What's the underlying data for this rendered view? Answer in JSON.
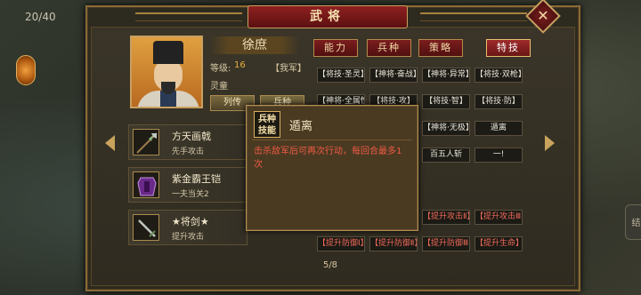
{
  "background": {
    "counter": "20/40",
    "side_button": "结"
  },
  "window": {
    "title": "武将",
    "close_icon": "close-icon"
  },
  "general": {
    "name": "徐庶",
    "level_label": "等级:",
    "level_value": "16",
    "faction": "【我军】",
    "attribute": "灵童",
    "bio_button": "列传",
    "troop_button": "兵种"
  },
  "tabs": [
    {
      "label": "能力",
      "active": false
    },
    {
      "label": "兵种",
      "active": false
    },
    {
      "label": "策略",
      "active": false
    },
    {
      "label": "特技",
      "active": true
    }
  ],
  "skills": {
    "row1": [
      "【将技·圣灵】",
      "【神将·奋战】",
      "【神将·异常】",
      "【将技·双枪】"
    ],
    "row2": [
      "【神将·全属性】",
      "【将技·攻】",
      "【将技·智】",
      "【将技·防】"
    ],
    "row3": [
      "【神将·无极】",
      "遁离"
    ],
    "row4": [
      "百五人斩",
      "一!"
    ],
    "row5": [
      "【提升攻击Ⅱ】",
      "【提升攻击Ⅲ】"
    ],
    "row6": [
      "【提升防御Ⅰ】",
      "【提升防御Ⅱ】",
      "【提升防御Ⅲ】",
      "【提升生命】"
    ]
  },
  "equipment": [
    {
      "name": "方天画戟",
      "desc": "先手攻击",
      "icon": "halberd-icon"
    },
    {
      "name": "紫金霸王铠",
      "desc": "一夫当关2",
      "icon": "armor-icon"
    },
    {
      "name": "★将剑★",
      "desc": "提升攻击",
      "icon": "sword-icon"
    }
  ],
  "popup": {
    "badge": "兵种技能",
    "title": "遁离",
    "description": "击杀敌军后可再次行动，每回合最多1次"
  },
  "pagination": "5/8"
}
